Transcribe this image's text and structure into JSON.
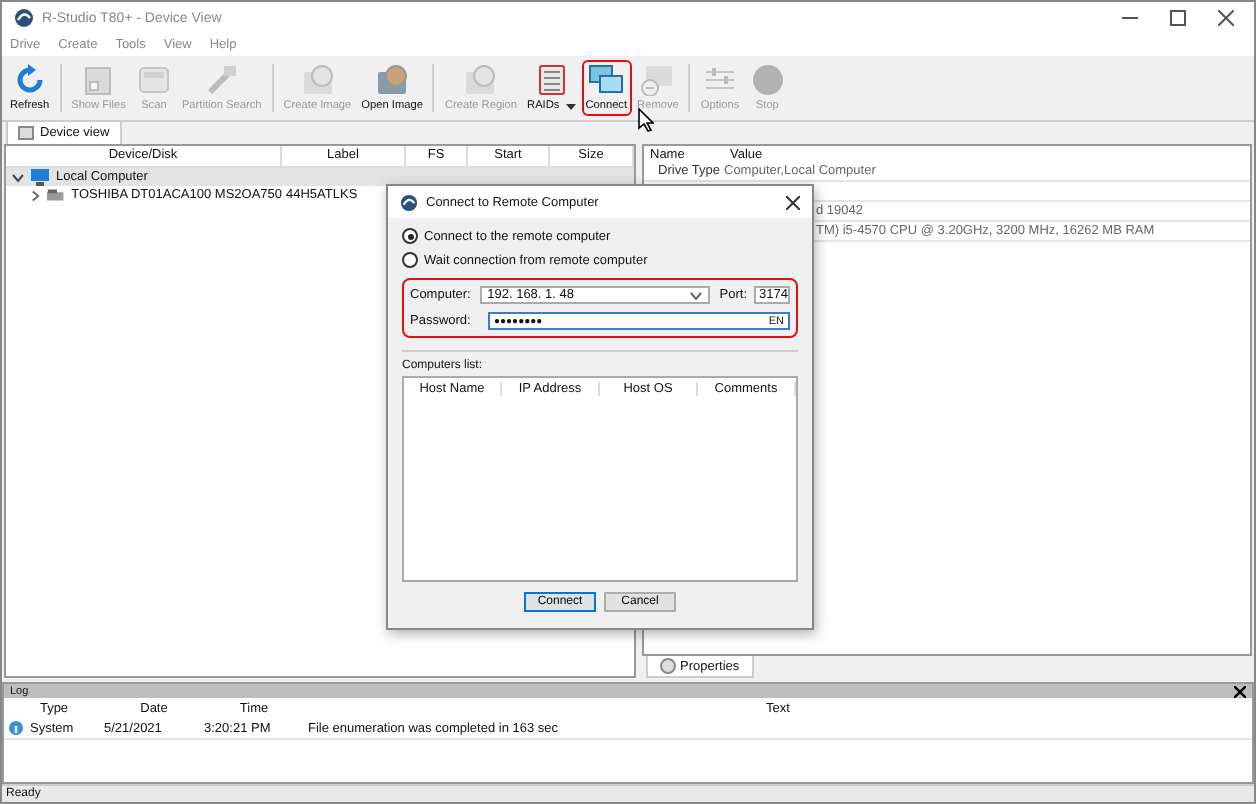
{
  "window": {
    "title": "R-Studio T80+ - Device View"
  },
  "menu": [
    "Drive",
    "Create",
    "Tools",
    "View",
    "Help"
  ],
  "toolbar": [
    [
      {
        "label": "Refresh",
        "disabled": false,
        "highlighted": false
      }
    ],
    [
      {
        "label": "Show Files",
        "disabled": true,
        "highlighted": false
      },
      {
        "label": "Scan",
        "disabled": true,
        "highlighted": false
      },
      {
        "label": "Partition Search",
        "disabled": true,
        "highlighted": false
      }
    ],
    [
      {
        "label": "Create Image",
        "disabled": true,
        "highlighted": false
      },
      {
        "label": "Open Image",
        "disabled": false,
        "highlighted": false
      }
    ],
    [
      {
        "label": "Create Region",
        "disabled": true,
        "highlighted": false
      },
      {
        "label": "RAIDs",
        "disabled": false,
        "highlighted": false,
        "dropdown": true
      },
      {
        "label": "Connect",
        "disabled": false,
        "highlighted": true
      },
      {
        "label": "Remove",
        "disabled": true,
        "highlighted": false
      }
    ],
    [
      {
        "label": "Options",
        "disabled": true,
        "highlighted": false
      },
      {
        "label": "Stop",
        "disabled": true,
        "highlighted": false
      }
    ]
  ],
  "view_tab": {
    "label": "Device view"
  },
  "device_table": {
    "columns": [
      "Device/Disk",
      "Label",
      "FS",
      "Start",
      "Size"
    ],
    "rows": [
      {
        "name": "Local Computer",
        "selected": true,
        "expanded": true,
        "children": [
          {
            "name": "TOSHIBA DT01ACA100 MS2OA750",
            "label": "44H5ATLKS",
            "expanded": false
          }
        ]
      }
    ]
  },
  "properties": {
    "columns": [
      "Name",
      "Value"
    ],
    "rows": [
      {
        "name": "Drive Type",
        "value": "Computer,Local Computer"
      },
      {
        "name": "",
        "value": ""
      },
      {
        "name": "",
        "value": "d 19042"
      },
      {
        "name": "",
        "value": "TM) i5-4570 CPU @ 3.20GHz, 3200 MHz, 16262 MB RAM"
      }
    ],
    "tab": "Properties"
  },
  "dialog": {
    "title": "Connect to Remote Computer",
    "options": [
      {
        "label": "Connect to the remote computer",
        "selected": true
      },
      {
        "label": "Wait connection from remote computer",
        "selected": false
      }
    ],
    "highlighted": true,
    "computer_label": "Computer:",
    "computer": "192. 168. 1. 48",
    "port_label": "Port:",
    "port": "3174",
    "password_label": "Password:",
    "password": "●●●●●●●●",
    "keyboard": "EN",
    "list_label": "Computers list:",
    "list_columns": [
      "Host Name",
      "IP Address",
      "Host OS",
      "Comments"
    ],
    "buttons": [
      {
        "label": "Connect",
        "selected": true
      },
      {
        "label": "Cancel",
        "selected": false
      }
    ]
  },
  "log": {
    "title": "Log",
    "columns": [
      "Type",
      "Date",
      "Time",
      "Text"
    ],
    "rows": [
      {
        "type": "System",
        "date": "5/21/2021",
        "time": "3:20:21 PM",
        "text": "File enumeration was completed in 163 sec"
      }
    ]
  },
  "status_bar": "Ready"
}
